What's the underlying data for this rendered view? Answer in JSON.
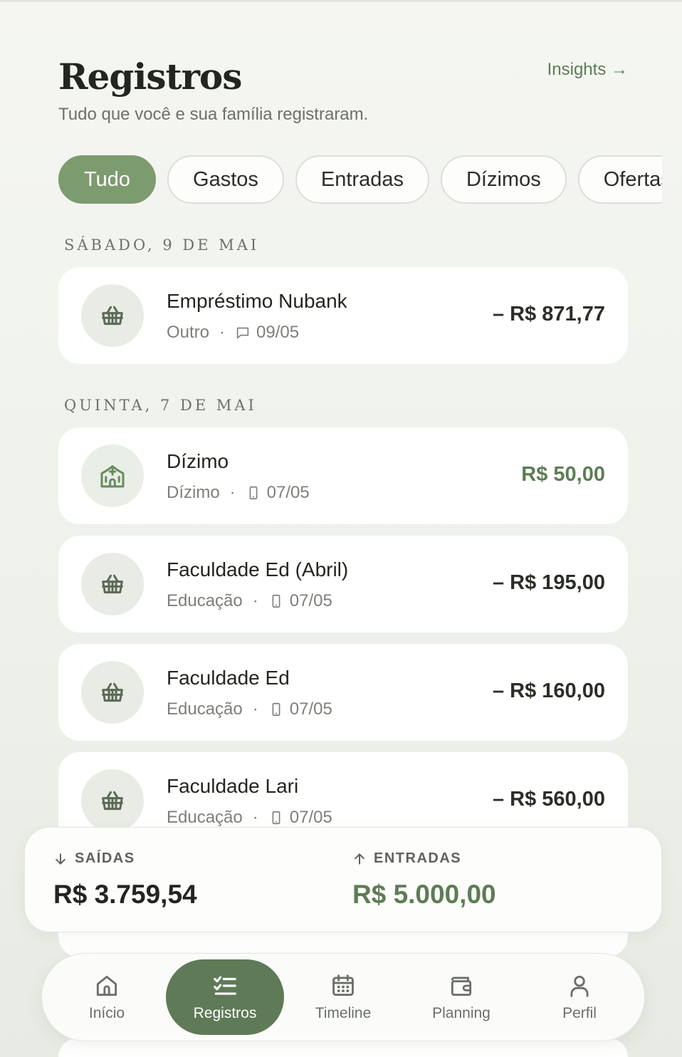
{
  "header": {
    "title": "Registros",
    "subtitle": "Tudo que você e sua família registraram.",
    "insights_link": "Insights →"
  },
  "filters": [
    {
      "label": "Tudo",
      "active": true
    },
    {
      "label": "Gastos",
      "active": false
    },
    {
      "label": "Entradas",
      "active": false
    },
    {
      "label": "Dízimos",
      "active": false
    },
    {
      "label": "Ofertas",
      "active": false
    }
  ],
  "sections": [
    {
      "label": "SÁBADO, 9 DE MAI",
      "items": [
        {
          "name": "Empréstimo Nubank",
          "category": "Outro",
          "source_icon": "chat-icon",
          "date": "09/05",
          "amount": "– R$ 871,77",
          "type": "expense",
          "icon": "basket-icon"
        }
      ]
    },
    {
      "label": "QUINTA, 7 DE MAI",
      "items": [
        {
          "name": "Dízimo",
          "category": "Dízimo",
          "source_icon": "phone-icon",
          "date": "07/05",
          "amount": "R$ 50,00",
          "type": "income",
          "icon": "church-icon"
        },
        {
          "name": "Faculdade Ed (Abril)",
          "category": "Educação",
          "source_icon": "phone-icon",
          "date": "07/05",
          "amount": "– R$ 195,00",
          "type": "expense",
          "icon": "basket-icon"
        },
        {
          "name": "Faculdade Ed",
          "category": "Educação",
          "source_icon": "phone-icon",
          "date": "07/05",
          "amount": "– R$ 160,00",
          "type": "expense",
          "icon": "basket-icon"
        },
        {
          "name": "Faculdade Lari",
          "category": "Educação",
          "source_icon": "phone-icon",
          "date": "07/05",
          "amount": "– R$ 560,00",
          "type": "expense",
          "icon": "basket-icon"
        }
      ]
    }
  ],
  "summary": {
    "saidas_label": "SAÍDAS",
    "saidas_value": "R$ 3.759,54",
    "entradas_label": "ENTRADAS",
    "entradas_value": "R$ 5.000,00"
  },
  "nav": [
    {
      "label": "Início",
      "icon": "home-icon",
      "active": false
    },
    {
      "label": "Registros",
      "icon": "checklist-icon",
      "active": true
    },
    {
      "label": "Timeline",
      "icon": "calendar-icon",
      "active": false
    },
    {
      "label": "Planning",
      "icon": "wallet-icon",
      "active": false
    },
    {
      "label": "Perfil",
      "icon": "user-icon",
      "active": false
    }
  ],
  "colors": {
    "accent": "#7c9b6e",
    "nav_active": "#5f7a56",
    "income_text": "#5d7d55"
  }
}
